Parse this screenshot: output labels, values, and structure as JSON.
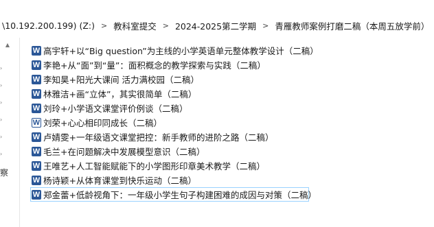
{
  "breadcrumb": [
    "\\10.192.200.199) (Z:)",
    "教科室提交",
    "2024-2025第二学期",
    "青雁教师案例打磨二稿（本周五放学前）"
  ],
  "nav_pane": {
    "peek_text": "察"
  },
  "files": [
    {
      "name": "高宇轩+以“Big question”为主线的小学英语单元整体教学设计（二稿）",
      "icon": "word-icon"
    },
    {
      "name": "李艳+从“面”到“量”：面积概念的教学探索与实践（二稿）",
      "icon": "word-icon"
    },
    {
      "name": "李知昊+阳光大课间 活力满校园（二稿）",
      "icon": "word-icon"
    },
    {
      "name": "林雅洁+画“立体”，其实很简单（二稿）",
      "icon": "word-icon"
    },
    {
      "name": "刘玲+小学语文课堂评价例谈（二稿）",
      "icon": "word-icon"
    },
    {
      "name": "刘荣+心心相印同成长（二稿）",
      "icon": "word-icon-plain"
    },
    {
      "name": "卢婧雯+一年级语文课堂把控：新手教师的进阶之路（二稿）",
      "icon": "word-icon"
    },
    {
      "name": "毛兰+在问题解决中发展模型意识（二稿）",
      "icon": "word-icon"
    },
    {
      "name": "王唯艺+人工智能赋能下的小学图形印章美术教学（二稿）",
      "icon": "word-icon"
    },
    {
      "name": "杨诗颖+从体育课堂到快乐运动（二稿）",
      "icon": "word-icon"
    },
    {
      "name": "郑金蕾+低龄视角下：一年级小学生句子构建困难的成因与对策（二稿）",
      "icon": "word-icon"
    }
  ],
  "icon_letter": "W"
}
